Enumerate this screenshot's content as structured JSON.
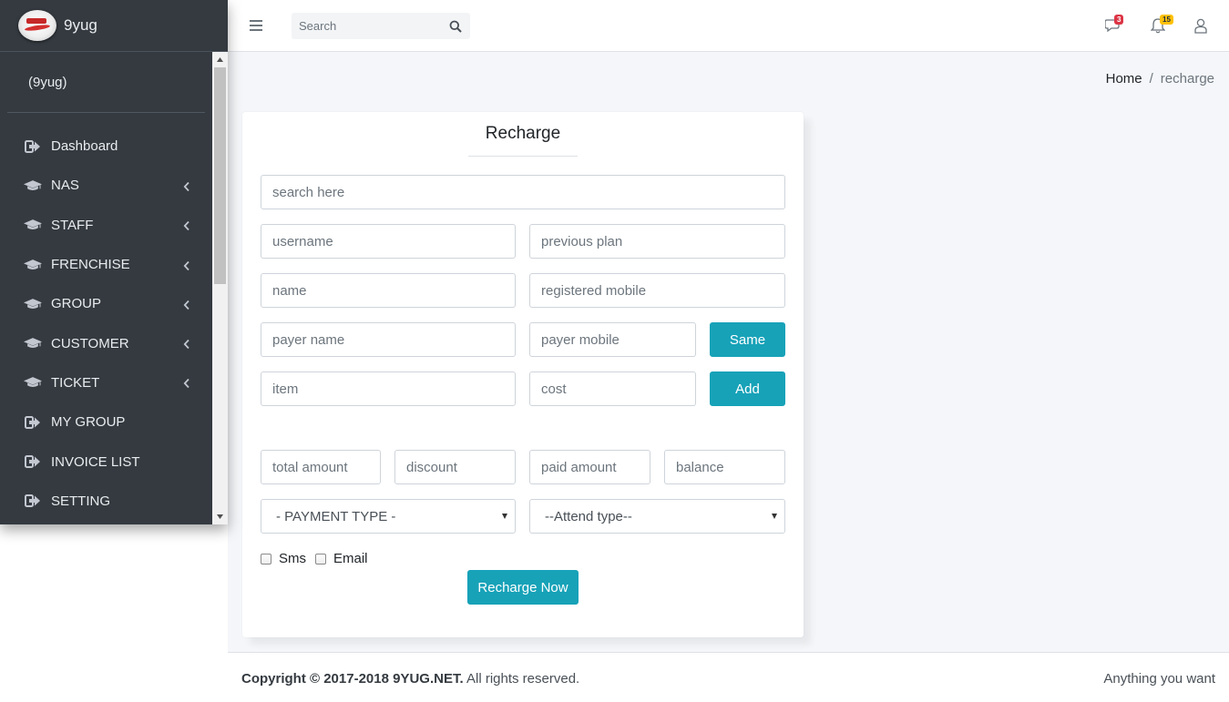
{
  "brand": {
    "name": "9yug"
  },
  "sidebar": {
    "user": "(9yug)",
    "items": [
      {
        "label": "Dashboard",
        "icon": "sign-in-icon",
        "has_submenu": false
      },
      {
        "label": "NAS",
        "icon": "graduation-cap-icon",
        "has_submenu": true
      },
      {
        "label": "STAFF",
        "icon": "graduation-cap-icon",
        "has_submenu": true
      },
      {
        "label": "FRENCHISE",
        "icon": "graduation-cap-icon",
        "has_submenu": true
      },
      {
        "label": "GROUP",
        "icon": "graduation-cap-icon",
        "has_submenu": true
      },
      {
        "label": "CUSTOMER",
        "icon": "graduation-cap-icon",
        "has_submenu": true
      },
      {
        "label": "TICKET",
        "icon": "graduation-cap-icon",
        "has_submenu": true
      },
      {
        "label": "MY GROUP",
        "icon": "sign-in-icon",
        "has_submenu": false
      },
      {
        "label": "INVOICE LIST",
        "icon": "sign-in-icon",
        "has_submenu": false
      },
      {
        "label": "SETTING",
        "icon": "sign-in-icon",
        "has_submenu": false
      }
    ]
  },
  "topbar": {
    "search_placeholder": "Search",
    "messages_count": "3",
    "notifications_count": "15"
  },
  "breadcrumb": {
    "home": "Home",
    "separator": "/",
    "current": "recharge"
  },
  "form": {
    "title": "Recharge",
    "placeholders": {
      "search": "search here",
      "username": "username",
      "previous_plan": "previous plan",
      "name": "name",
      "registered_mobile": "registered mobile",
      "payer_name": "payer name",
      "payer_mobile": "payer mobile",
      "item": "item",
      "cost": "cost",
      "total_amount": "total amount",
      "discount": "discount",
      "paid_amount": "paid amount",
      "balance": "balance"
    },
    "same_button": "Same",
    "add_button": "Add",
    "payment_type": "- PAYMENT TYPE -",
    "attend_type": "--Attend type--",
    "sms_label": "Sms",
    "email_label": "Email",
    "submit_button": "Recharge Now"
  },
  "footer": {
    "copyright_prefix": "Copyright © 2017-2018 ",
    "company": "9YUG.NET.",
    "rights": " All rights reserved.",
    "tagline": "Anything you want"
  },
  "colors": {
    "sidebar_bg": "#343a40",
    "accent": "#17a2b8",
    "content_bg": "#f4f6f9"
  }
}
